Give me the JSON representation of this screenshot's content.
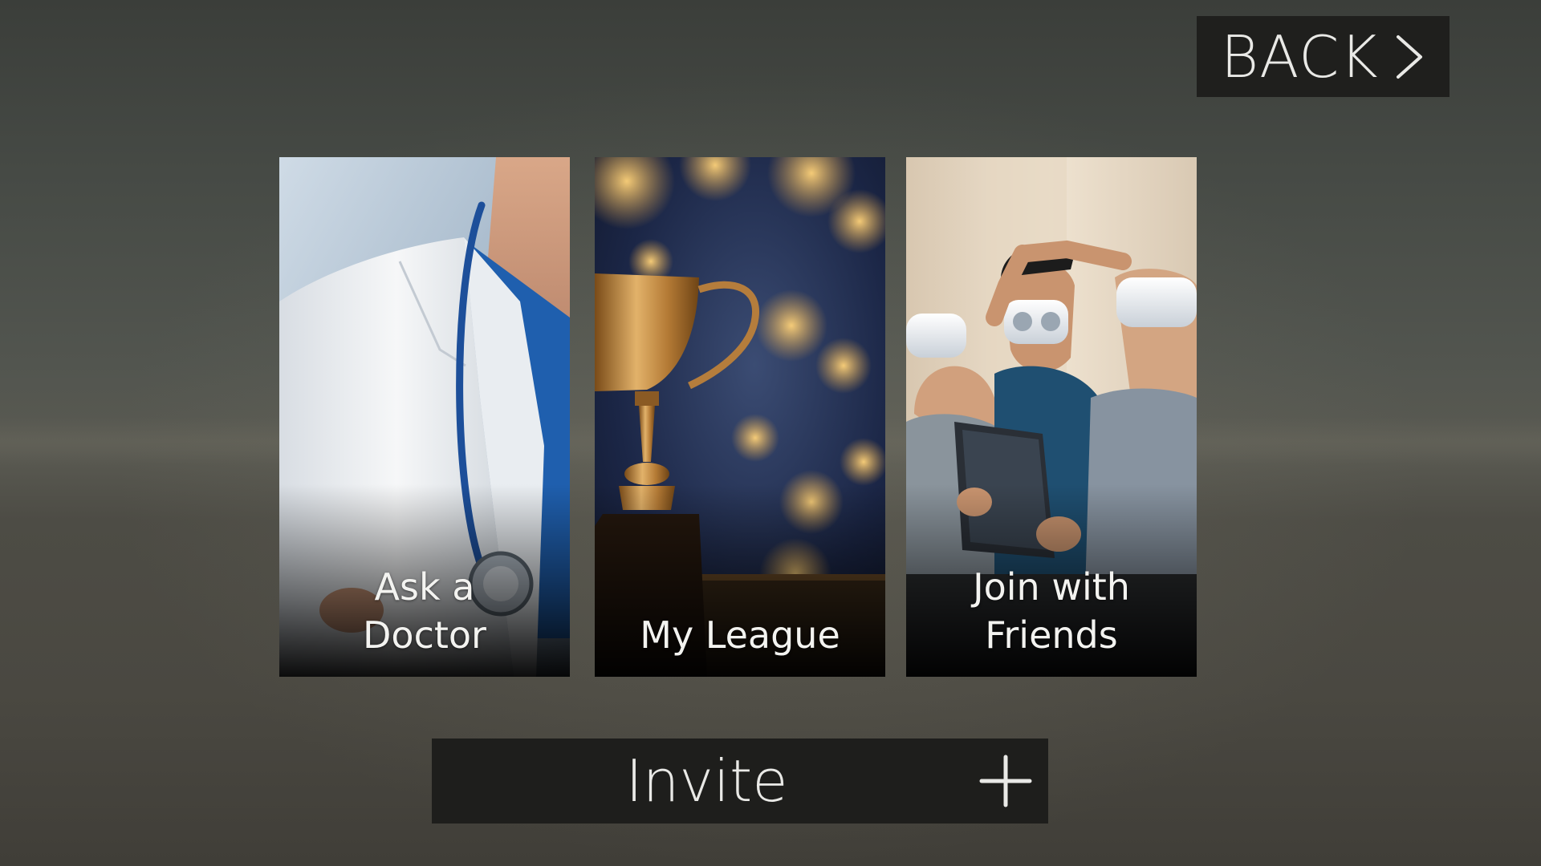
{
  "navigation": {
    "back_label": "BACK",
    "back_icon": "chevron-right-icon"
  },
  "cards": [
    {
      "label": "Ask a\nDoctor",
      "image": "doctor-with-stethoscope"
    },
    {
      "label": "My League",
      "image": "trophy-bokeh"
    },
    {
      "label": "Join with\nFriends",
      "image": "friends-vr-headsets"
    }
  ],
  "invite": {
    "label": "Invite",
    "icon": "plus-icon"
  },
  "colors": {
    "background_top": "#3b3e3a",
    "background_bottom": "#403e38",
    "button_background": "#1f1f1d",
    "text": "#e9e9e6"
  }
}
